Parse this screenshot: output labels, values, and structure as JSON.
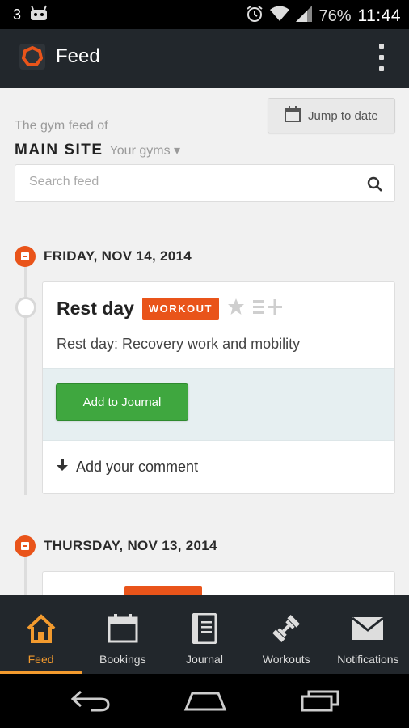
{
  "status_bar": {
    "notification_count": "3",
    "battery": "76%",
    "time": "11:44",
    "icons": [
      "android-debug-icon",
      "alarm-icon",
      "wifi-icon",
      "signal-icon",
      "battery-icon"
    ]
  },
  "app_bar": {
    "title": "Feed",
    "logo_icon": "gym-logo-icon",
    "overflow_icon": "more-vert-icon"
  },
  "header": {
    "jump_to_date": "Jump to date",
    "gym_feed_of": "The gym feed of",
    "gym_name": "MAIN SITE",
    "your_gyms": "Your gyms ▾",
    "search_placeholder": "Search feed"
  },
  "feed": [
    {
      "date": "FRIDAY, NOV 14, 2014",
      "title": "Rest day",
      "badge": "WORKOUT",
      "description": "Rest day: Recovery work and mobility",
      "add_to_journal": "Add to Journal",
      "add_comment": "Add your comment"
    },
    {
      "date": "THURSDAY, NOV 13, 2014"
    }
  ],
  "tabs": [
    {
      "label": "Feed",
      "icon": "home-icon",
      "active": true
    },
    {
      "label": "Bookings",
      "icon": "calendar-icon",
      "active": false
    },
    {
      "label": "Journal",
      "icon": "journal-icon",
      "active": false
    },
    {
      "label": "Workouts",
      "icon": "dumbbell-icon",
      "active": false
    },
    {
      "label": "Notifications",
      "icon": "envelope-icon",
      "active": false
    }
  ],
  "colors": {
    "accent": "#e9541a",
    "tab_active": "#f29a2e",
    "app_bar": "#22272c",
    "journal_button": "#3fa73f"
  }
}
